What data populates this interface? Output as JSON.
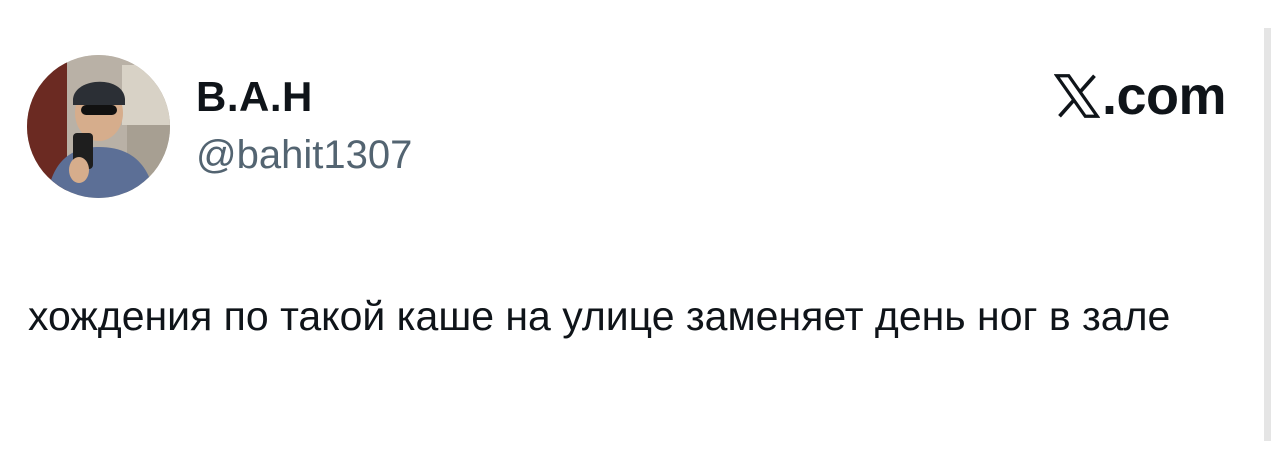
{
  "post": {
    "author_name": "В.А.Н",
    "author_handle": "@bahit1307",
    "text": "хождения по такой каше на улице заменяет день ног в зале"
  },
  "brand": {
    "logo_icon": "x-logo-icon",
    "text": ".com"
  },
  "colors": {
    "text": "#0f1419",
    "secondary_text": "#536471",
    "background": "#ffffff"
  }
}
